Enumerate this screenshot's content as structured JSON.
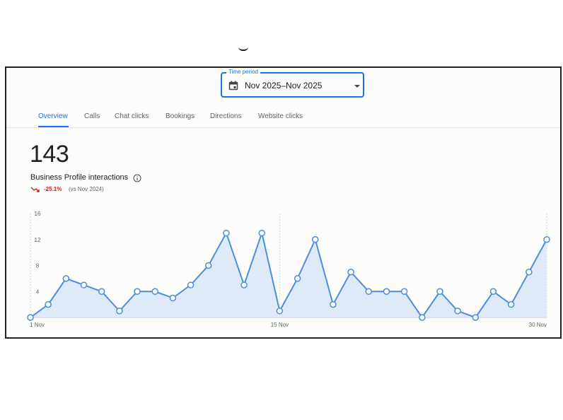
{
  "time_period": {
    "label": "Time period",
    "value": "Nov 2025–Nov 2025"
  },
  "tabs": [
    {
      "label": "Overview",
      "active": true
    },
    {
      "label": "Calls"
    },
    {
      "label": "Chat clicks"
    },
    {
      "label": "Bookings"
    },
    {
      "label": "Directions"
    },
    {
      "label": "Website clicks"
    }
  ],
  "metric": {
    "value": "143",
    "label": "Business Profile interactions",
    "change": "-25.1%",
    "comparison": "(vs Nov 2024)",
    "change_color": "#c5221f"
  },
  "icons": [
    "calendar-icon",
    "dropdown-arrow-icon",
    "info-icon",
    "trend-down-icon"
  ],
  "colors": {
    "accent": "#1a73e8",
    "line": "#4a8fdc",
    "fill": "#dce8f8"
  },
  "chart_data": {
    "type": "area",
    "x": [
      1,
      2,
      3,
      4,
      5,
      6,
      7,
      8,
      9,
      10,
      11,
      12,
      13,
      14,
      15,
      16,
      17,
      18,
      19,
      20,
      21,
      22,
      23,
      24,
      25,
      26,
      27,
      28,
      29,
      30
    ],
    "values": [
      0,
      2,
      6,
      5,
      4,
      1,
      4,
      4,
      3,
      5,
      8,
      13,
      5,
      13,
      1,
      6,
      12,
      2,
      7,
      4,
      4,
      4,
      0,
      4,
      1,
      0,
      4,
      2,
      7,
      12
    ],
    "xtick_labels": [
      "1 Nov",
      "15 Nov",
      "30 Nov"
    ],
    "xtick_days": [
      1,
      15,
      30
    ],
    "yticks": [
      4,
      8,
      12,
      16
    ],
    "ylim": [
      0,
      16
    ],
    "grid": "dashed vertical lines at day 1, 15, 30"
  }
}
